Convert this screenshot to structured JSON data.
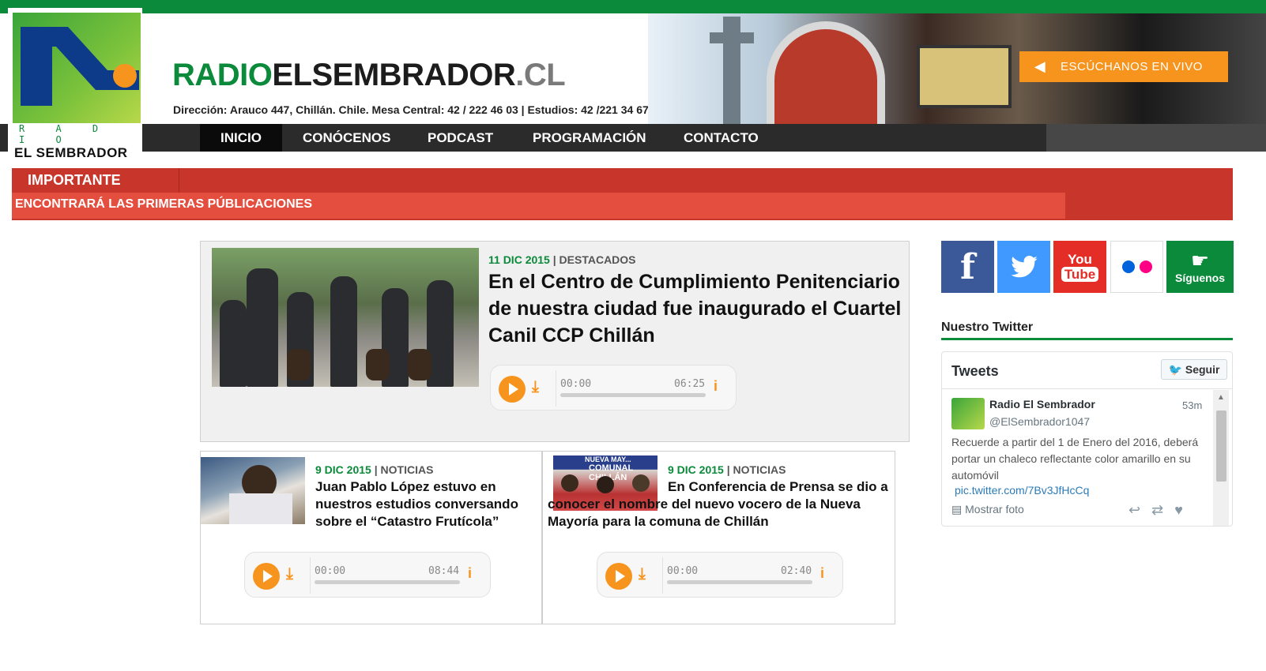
{
  "colors": {
    "brand_green": "#0a8a3a",
    "accent_orange": "#f7941d",
    "alert_red": "#c8352b",
    "nav_dark": "#2b2b2b"
  },
  "logo": {
    "radio": "R A D I O",
    "name": "EL SEMBRADOR"
  },
  "header": {
    "title_part1": "RADIO",
    "title_part2": "ELSEMBRADOR",
    "title_part3": ".CL",
    "address": "Dirección: Arauco 447, Chillán. Chile. Mesa Central: 42 / 222 46 03 | Estudios: 42 /221 34 67",
    "listen_label": "ESCÚCHANOS EN VIVO",
    "listen_icon": "speaker-icon"
  },
  "nav": {
    "items": [
      {
        "label": "INICIO"
      },
      {
        "label": "CONÓCENOS"
      },
      {
        "label": "PODCAST"
      },
      {
        "label": "PROGRAMACIÓN"
      },
      {
        "label": "CONTACTO"
      }
    ]
  },
  "alert": {
    "tab": "IMPORTANTE",
    "message": "ENCONTRARÁ LAS PRIMERAS PÚBLICACIONES"
  },
  "featured": {
    "date": "11 DIC 2015",
    "separator": " | ",
    "category": "DESTACADOS",
    "title": "En el Centro de Cumplimiento Penitenciario de nuestra ciudad fue inaugurado el Cuartel Canil CCP Chillán",
    "player": {
      "current": "00:00",
      "total": "06:25",
      "progress": 0
    }
  },
  "articles": [
    {
      "date": "9 DIC 2015",
      "category": "NOTICIAS",
      "title": "Juan Pablo López estuvo en nuestros estudios conversando sobre el “Catastro Frutícola”",
      "player": {
        "current": "00:00",
        "total": "08:44",
        "progress": 0
      }
    },
    {
      "date": "9 DIC 2015",
      "category": "NOTICIAS",
      "title": "En Conferencia de Prensa se dio a conocer el nombre del nuevo vocero de la Nueva Mayoría para la comuna de Chillán",
      "photo_text_1": "NUEVA MAY...",
      "photo_text_2": "COMUNAL CHILLÁN",
      "player": {
        "current": "00:00",
        "total": "02:40",
        "progress": 0
      }
    }
  ],
  "social": [
    {
      "name": "facebook",
      "label": "f",
      "color": "#3b5998"
    },
    {
      "name": "twitter",
      "label": "🐦",
      "color": "#4099ff"
    },
    {
      "name": "youtube",
      "label": "You Tube",
      "color": "#e52d27"
    },
    {
      "name": "flickr",
      "label": "●●",
      "color": "#ffffff"
    },
    {
      "name": "siguenos",
      "label": "Síguenos",
      "color": "#0a8a3a"
    }
  ],
  "twitter": {
    "heading": "Nuestro Twitter",
    "widget_title": "Tweets",
    "follow_label": "Seguir",
    "tweet": {
      "author": "Radio El Sembrador",
      "handle": "@ElSembrador1047",
      "time": "53m",
      "text": "Recuerde a partir del 1 de Enero del 2016, deberá portar un chaleco reflectante color amarillo  en su automóvil",
      "link": "pic.twitter.com/7Bv3JfHcCq",
      "show_photo": "Mostrar foto"
    }
  }
}
